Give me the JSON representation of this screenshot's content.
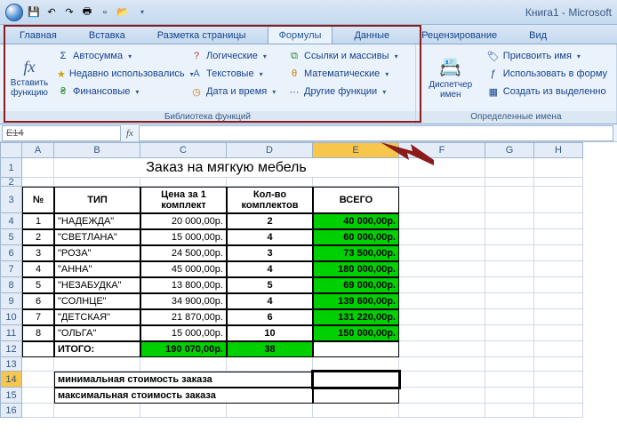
{
  "title": "Книга1 - Microsoft",
  "tabs": [
    "Главная",
    "Вставка",
    "Разметка страницы",
    "Формулы",
    "Данные",
    "Рецензирование",
    "Вид"
  ],
  "activeTab": 3,
  "ribbon": {
    "insertFn": "Вставить функцию",
    "libCol1": [
      "Автосумма",
      "Недавно использовались",
      "Финансовые"
    ],
    "libCol2": [
      "Логические",
      "Текстовые",
      "Дата и время"
    ],
    "libCol3": [
      "Ссылки и массивы",
      "Математические",
      "Другие функции"
    ],
    "libLabel": "Библиотека функций",
    "nameMgr": "Диспетчер имен",
    "namesCol": [
      "Присвоить имя",
      "Использовать в форму",
      "Создать из выделенно"
    ],
    "namesLabel": "Определенные имена"
  },
  "namebox": "E14",
  "cols": [
    "A",
    "B",
    "C",
    "D",
    "E",
    "F",
    "G",
    "H"
  ],
  "sheetTitle": "Заказ на мягкую мебель",
  "hdr": {
    "num": "№",
    "type": "ТИП",
    "price": "Цена за 1 комплект",
    "qty": "Кол-во комплектов",
    "total": "ВСЕГО"
  },
  "rows": [
    {
      "n": "1",
      "t": "\"НАДЕЖДА\"",
      "p": "20 000,00р.",
      "q": "2",
      "v": "40 000,00р."
    },
    {
      "n": "2",
      "t": "\"СВЕТЛАНА\"",
      "p": "15 000,00р.",
      "q": "4",
      "v": "60 000,00р."
    },
    {
      "n": "3",
      "t": "\"РОЗА\"",
      "p": "24 500,00р.",
      "q": "3",
      "v": "73 500,00р."
    },
    {
      "n": "4",
      "t": "\"АННА\"",
      "p": "45 000,00р.",
      "q": "4",
      "v": "180 000,00р."
    },
    {
      "n": "5",
      "t": "\"НЕЗАБУДКА\"",
      "p": "13 800,00р.",
      "q": "5",
      "v": "69 000,00р."
    },
    {
      "n": "6",
      "t": "\"СОЛНЦЕ\"",
      "p": "34 900,00р.",
      "q": "4",
      "v": "139 600,00р."
    },
    {
      "n": "7",
      "t": "\"ДЕТСКАЯ\"",
      "p": "21 870,00р.",
      "q": "6",
      "v": "131 220,00р."
    },
    {
      "n": "8",
      "t": "\"ОЛЬГА\"",
      "p": "15 000,00р.",
      "q": "10",
      "v": "150 000,00р."
    }
  ],
  "total": {
    "label": "ИТОГО:",
    "p": "190 070,00р.",
    "q": "38"
  },
  "min": "минимальная стоимость заказа",
  "max": "максимальная стоимость заказа"
}
